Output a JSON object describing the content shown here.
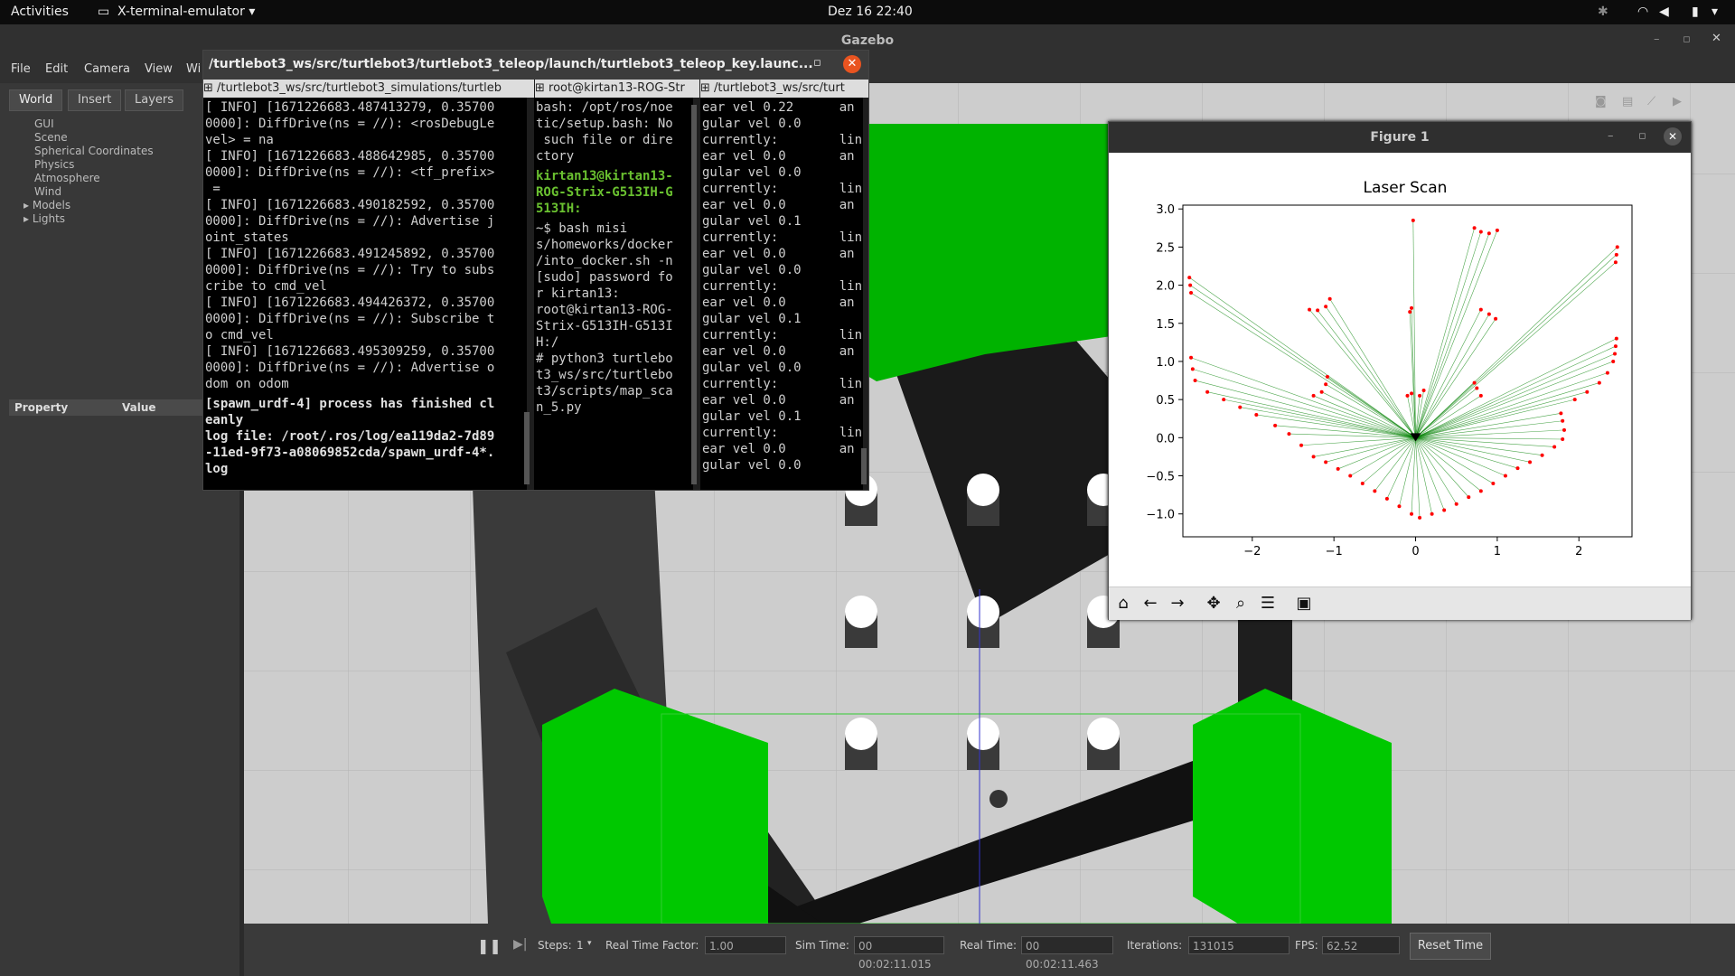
{
  "topbar": {
    "activities": "Activities",
    "app": "X-terminal-emulator",
    "datetime": "Dez 16  22:40"
  },
  "gazebo": {
    "title": "Gazebo",
    "menu": [
      "File",
      "Edit",
      "Camera",
      "View",
      "Wi"
    ],
    "tabs": [
      "World",
      "Insert",
      "Layers"
    ],
    "tree": [
      "GUI",
      "Scene",
      "Spherical Coordinates",
      "Physics",
      "Atmosphere",
      "Wind",
      "Models",
      "Lights"
    ],
    "property_header": "Property",
    "value_header": "Value",
    "status": {
      "steps_label": "Steps:",
      "steps_value": "1",
      "rtf_label": "Real Time Factor:",
      "rtf_value": "1.00",
      "sim_label": "Sim Time:",
      "sim_value": "00 00:02:11.015",
      "real_label": "Real Time:",
      "real_value": "00 00:02:11.463",
      "iter_label": "Iterations:",
      "iter_value": "131015",
      "fps_label": "FPS:",
      "fps_value": "62.52",
      "reset": "Reset Time"
    }
  },
  "terminal": {
    "title": "/turtlebot3_ws/src/turtlebot3/turtlebot3_teleop/launch/turtlebot3_teleop_key.launc...",
    "tabs": [
      "/turtlebot3_ws/src/turtlebot3_simulations/turtleb",
      "root@kirtan13-ROG-Str",
      "/turtlebot3_ws/src/turt"
    ],
    "pane1": "[ INFO] [1671226683.487413279, 0.35700\n0000]: DiffDrive(ns = //): <rosDebugLe\nvel> = na\n[ INFO] [1671226683.488642985, 0.35700\n0000]: DiffDrive(ns = //): <tf_prefix>\n =\n[ INFO] [1671226683.490182592, 0.35700\n0000]: DiffDrive(ns = //): Advertise j\noint_states\n[ INFO] [1671226683.491245892, 0.35700\n0000]: DiffDrive(ns = //): Try to subs\ncribe to cmd_vel\n[ INFO] [1671226683.494426372, 0.35700\n0000]: DiffDrive(ns = //): Subscribe t\no cmd_vel\n[ INFO] [1671226683.495309259, 0.35700\n0000]: DiffDrive(ns = //): Advertise o\ndom on odom",
    "pane1_bold": "[spawn_urdf-4] process has finished cl\neanly\nlog file: /root/.ros/log/ea119da2-7d89\n-11ed-9f73-a08069852cda/spawn_urdf-4*.\nlog",
    "pane2_a": "bash: /opt/ros/noe\ntic/setup.bash: No\n such file or dire\nctory",
    "pane2_prompt": "kirtan13@kirtan13-\nROG-Strix-G513IH-G\n513IH:",
    "pane2_b": "~$ bash misi\ns/homeworks/docker\n/into_docker.sh -n\n[sudo] password fo\nr kirtan13:\nroot@kirtan13-ROG-\nStrix-G513IH-G513I\nH:/\n# python3 turtlebo\nt3_ws/src/turtlebo\nt3/scripts/map_sca\nn_5.py",
    "pane3": "ear vel 0.22      an\ngular vel 0.0\ncurrently:        lin\near vel 0.0       an\ngular vel 0.0\ncurrently:        lin\near vel 0.0       an\ngular vel 0.1\ncurrently:        lin\near vel 0.0       an\ngular vel 0.0\ncurrently:        lin\near vel 0.0       an\ngular vel 0.1\ncurrently:        lin\near vel 0.0       an\ngular vel 0.0\ncurrently:        lin\near vel 0.0       an\ngular vel 0.1\ncurrently:        lin\near vel 0.0       an\ngular vel 0.0"
  },
  "figure": {
    "window_title": "Figure 1",
    "toolbar": [
      "home-icon",
      "back-icon",
      "forward-icon",
      "pan-icon",
      "zoom-icon",
      "configure-icon",
      "save-icon"
    ]
  },
  "chart_data": {
    "type": "scatter",
    "title": "Laser Scan",
    "xlabel": "",
    "ylabel": "",
    "xlim": [
      -2.85,
      2.65
    ],
    "ylim": [
      -1.3,
      3.05
    ],
    "xticks": [
      -2,
      -1,
      0,
      1,
      2
    ],
    "yticks": [
      -1.0,
      -0.5,
      0.0,
      0.5,
      1.0,
      1.5,
      2.0,
      2.5,
      3.0
    ],
    "origin": [
      0,
      0
    ],
    "point_color": "#ff0000",
    "ray_color": "#008000",
    "series": [
      {
        "values": [
          [
            -1.25,
            -0.25
          ],
          [
            -1.1,
            -0.32
          ],
          [
            -0.95,
            -0.41
          ],
          [
            -0.8,
            -0.5
          ],
          [
            -0.65,
            -0.6
          ],
          [
            -0.5,
            -0.7
          ],
          [
            -0.35,
            -0.8
          ],
          [
            -0.2,
            -0.9
          ],
          [
            -0.05,
            -1.0
          ],
          [
            0.05,
            -1.05
          ],
          [
            0.2,
            -1.0
          ],
          [
            0.35,
            -0.95
          ],
          [
            0.5,
            -0.87
          ],
          [
            0.65,
            -0.78
          ],
          [
            0.8,
            -0.7
          ],
          [
            0.95,
            -0.6
          ],
          [
            1.1,
            -0.5
          ],
          [
            1.25,
            -0.4
          ],
          [
            1.4,
            -0.32
          ],
          [
            1.55,
            -0.23
          ],
          [
            1.7,
            -0.12
          ],
          [
            1.8,
            -0.02
          ],
          [
            -1.4,
            -0.1
          ],
          [
            -1.55,
            0.05
          ],
          [
            -1.72,
            0.16
          ],
          [
            -1.95,
            0.3
          ],
          [
            -2.15,
            0.4
          ],
          [
            -2.35,
            0.5
          ],
          [
            -2.55,
            0.6
          ],
          [
            -2.7,
            0.75
          ],
          [
            -2.73,
            0.9
          ],
          [
            -2.75,
            1.05
          ],
          [
            -2.75,
            1.9
          ],
          [
            -2.76,
            2.0
          ],
          [
            -2.77,
            2.1
          ],
          [
            -1.3,
            1.68
          ],
          [
            -1.2,
            1.67
          ],
          [
            -1.1,
            1.72
          ],
          [
            -1.05,
            1.82
          ],
          [
            -1.25,
            0.55
          ],
          [
            -1.15,
            0.6
          ],
          [
            -1.1,
            0.7
          ],
          [
            -1.08,
            0.8
          ],
          [
            -0.1,
            0.55
          ],
          [
            -0.05,
            0.58
          ],
          [
            0.05,
            0.55
          ],
          [
            0.1,
            0.62
          ],
          [
            -0.07,
            1.65
          ],
          [
            -0.05,
            1.7
          ],
          [
            -0.03,
            2.85
          ],
          [
            0.8,
            0.55
          ],
          [
            0.75,
            0.65
          ],
          [
            0.72,
            0.72
          ],
          [
            0.8,
            1.68
          ],
          [
            0.9,
            1.62
          ],
          [
            0.98,
            1.56
          ],
          [
            0.72,
            2.75
          ],
          [
            0.8,
            2.7
          ],
          [
            0.9,
            2.68
          ],
          [
            1.0,
            2.72
          ],
          [
            1.78,
            0.32
          ],
          [
            1.8,
            0.22
          ],
          [
            1.82,
            0.1
          ],
          [
            1.95,
            0.5
          ],
          [
            2.1,
            0.6
          ],
          [
            2.25,
            0.72
          ],
          [
            2.35,
            0.85
          ],
          [
            2.42,
            1.0
          ],
          [
            2.44,
            1.1
          ],
          [
            2.45,
            1.2
          ],
          [
            2.46,
            1.3
          ],
          [
            2.45,
            2.3
          ],
          [
            2.46,
            2.4
          ],
          [
            2.47,
            2.5
          ]
        ]
      }
    ]
  }
}
